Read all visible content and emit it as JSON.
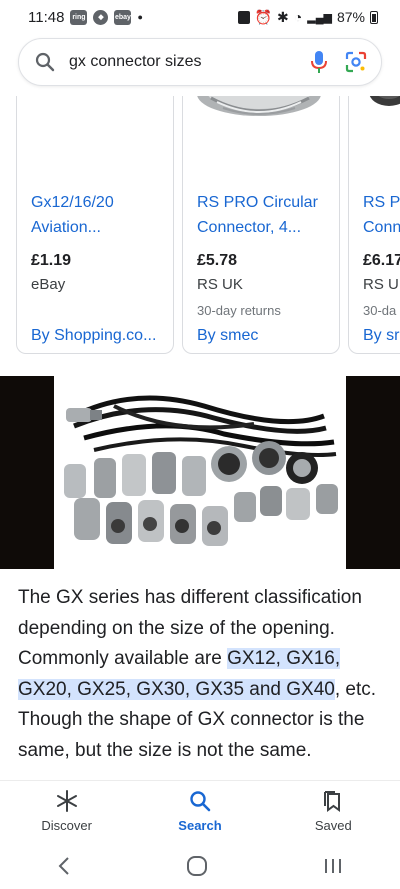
{
  "status": {
    "time": "11:48",
    "app_icons": [
      "ring",
      "vpn",
      "ebay"
    ],
    "battery": "87%"
  },
  "search": {
    "query": "gx connector sizes"
  },
  "products": [
    {
      "title_line1": "Gx12/16/20",
      "title_line2": "Aviation...",
      "price": "£1.19",
      "store": "eBay",
      "returns": "",
      "by": "By Shopping.co..."
    },
    {
      "title_line1": "RS PRO Circular",
      "title_line2": "Connector, 4...",
      "price": "£5.78",
      "store": "RS UK",
      "returns": "30-day returns",
      "by": "By smec"
    },
    {
      "title_line1": "RS Pl",
      "title_line2": "Conn",
      "price": "£6.17",
      "store": "RS UI",
      "returns": "30-da",
      "by": "By sr"
    }
  ],
  "snippet": {
    "part1": "The GX series has different classification depending on the size of the opening. Commonly available are ",
    "highlight": "GX12, GX16, GX20, GX25, GX30, GX35 and GX40",
    "part2": ", etc. Though the shape of GX connector is the same, but the size is not the same."
  },
  "bottom_nav": {
    "discover": "Discover",
    "search": "Search",
    "saved": "Saved"
  },
  "colors": {
    "link": "#1967d2",
    "highlight": "#d3e3fd"
  }
}
